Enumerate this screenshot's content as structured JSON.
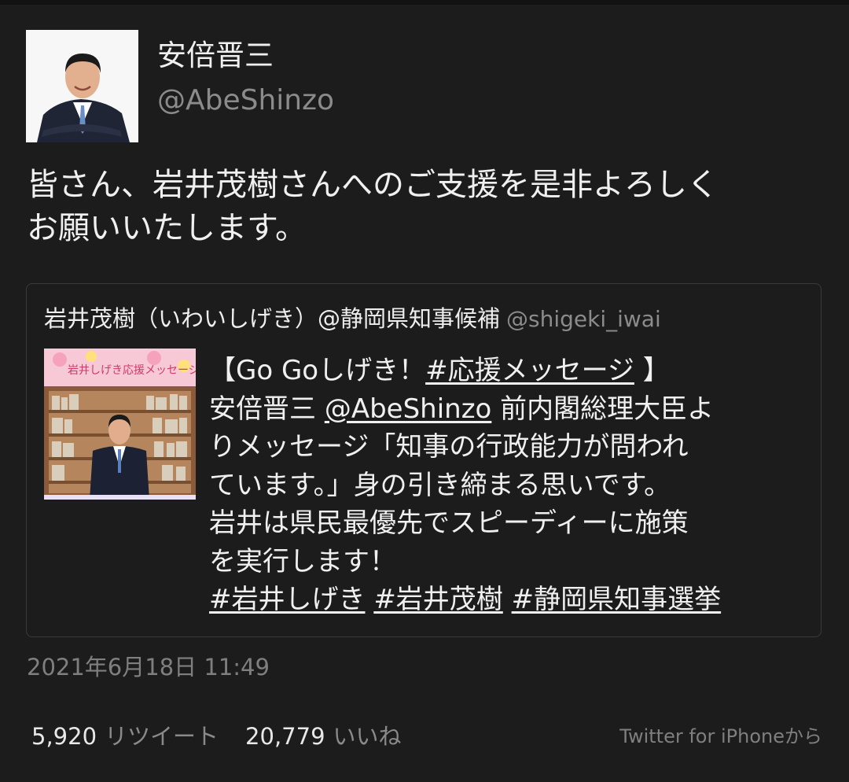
{
  "author": {
    "name": "安倍晋三",
    "handle": "@AbeShinzo"
  },
  "tweet": {
    "lines": [
      "皆さん、岩井茂樹さんへのご支援を是非よろしく",
      "お願いいたします。"
    ]
  },
  "quoted": {
    "author_name": "岩井茂樹（いわいしげき）@静岡県知事候補",
    "author_handle": "@shigeki_iwai",
    "thumbnail_banner": "岩井しげき応援メッセージ",
    "body": {
      "l1_pre": "【Go Goしげき！",
      "l1_tag": "#応援メッセージ",
      "l1_post": " 】",
      "l2_pre": "安倍晋三 ",
      "l2_mention": "@AbeShinzo",
      "l2_post": " 前内閣総理大臣よ",
      "l3": "りメッセージ「知事の行政能力が問われ",
      "l4": "ています。」身の引き締まる思いです。",
      "l5": "岩井は県民最優先でスピーディーに施策",
      "l6": "を実行します！",
      "tags": [
        "#岩井しげき",
        "#岩井茂樹",
        "#静岡県知事選挙"
      ]
    }
  },
  "timestamp": "2021年6月18日 11:49",
  "stats": {
    "retweets": "5,920",
    "retweets_label": "リツイート",
    "likes": "20,779",
    "likes_label": "いいね"
  },
  "source": "Twitter for iPhoneから",
  "colors": {
    "background": "#1c1c1c",
    "text": "#f0f0f0",
    "muted": "#8b8b8b",
    "border": "#3a3a3a"
  }
}
